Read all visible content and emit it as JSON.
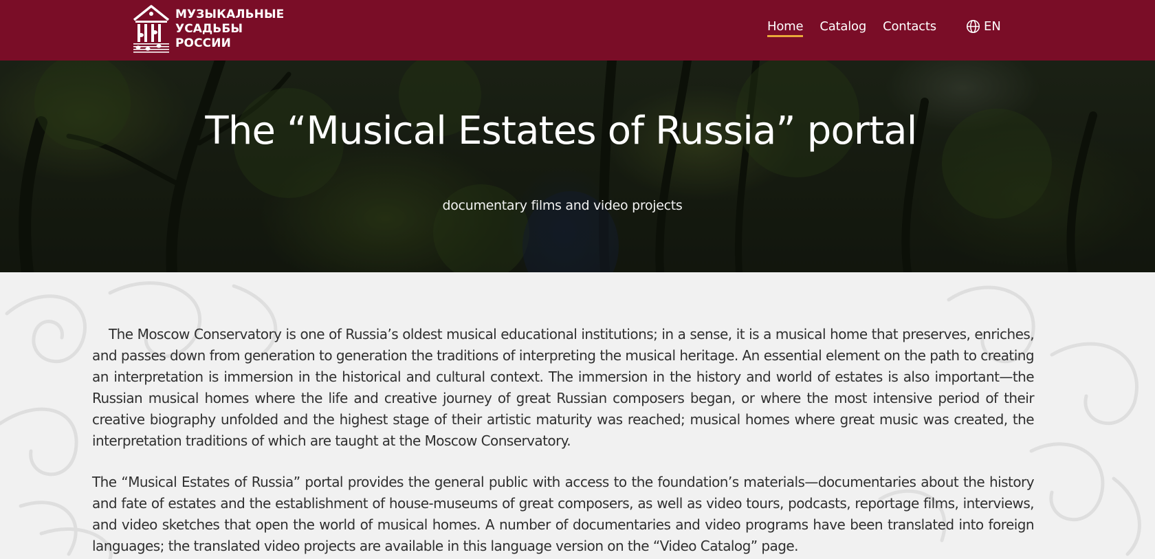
{
  "header": {
    "logo": {
      "line1": "МУЗЫКАЛЬНЫЕ",
      "line2": "УСАДЬБЫ",
      "line3": "РОССИИ"
    },
    "nav": [
      {
        "label": "Home",
        "active": true
      },
      {
        "label": "Catalog",
        "active": false
      },
      {
        "label": "Contacts",
        "active": false
      }
    ],
    "language": {
      "icon": "globe-icon",
      "label": "EN"
    }
  },
  "hero": {
    "title": "The “Musical Estates of Russia” portal",
    "subtitle": "documentary films and video projects"
  },
  "content": {
    "paragraphs": [
      "The Moscow Conservatory is one of Russia’s oldest musical educational institutions; in a sense, it is a musical home that preserves, enriches, and passes down from generation to generation the traditions of interpreting the musical heritage. An essential element on the path to creating an interpretation is immersion in the historical and cultural context. The immersion in the history and world of estates is also important—the Russian musical homes where the life and creative journey of great Russian composers began, or where the most intensive period of their creative biography unfolded and the highest stage of their artistic maturity was reached; musical homes where great music was created, the interpretation traditions of which are taught at the Moscow Conservatory.",
      "The “Musical Estates of Russia” portal provides the general public with access to the foundation’s materials—documentaries about the history and fate of estates and the establishment of house-museums of great composers, as well as video tours, podcasts, reportage films, interviews, and video sketches that open the world of musical homes. A number of documentaries and video programs have been translated into foreign languages; the translated video projects are available in this language version on the “Video Catalog” page."
    ]
  },
  "colors": {
    "header_bg": "#7a0d27",
    "nav_active_underline": "#e9a93a",
    "content_bg": "#f1f1f1",
    "body_text": "#2f2f2f"
  }
}
